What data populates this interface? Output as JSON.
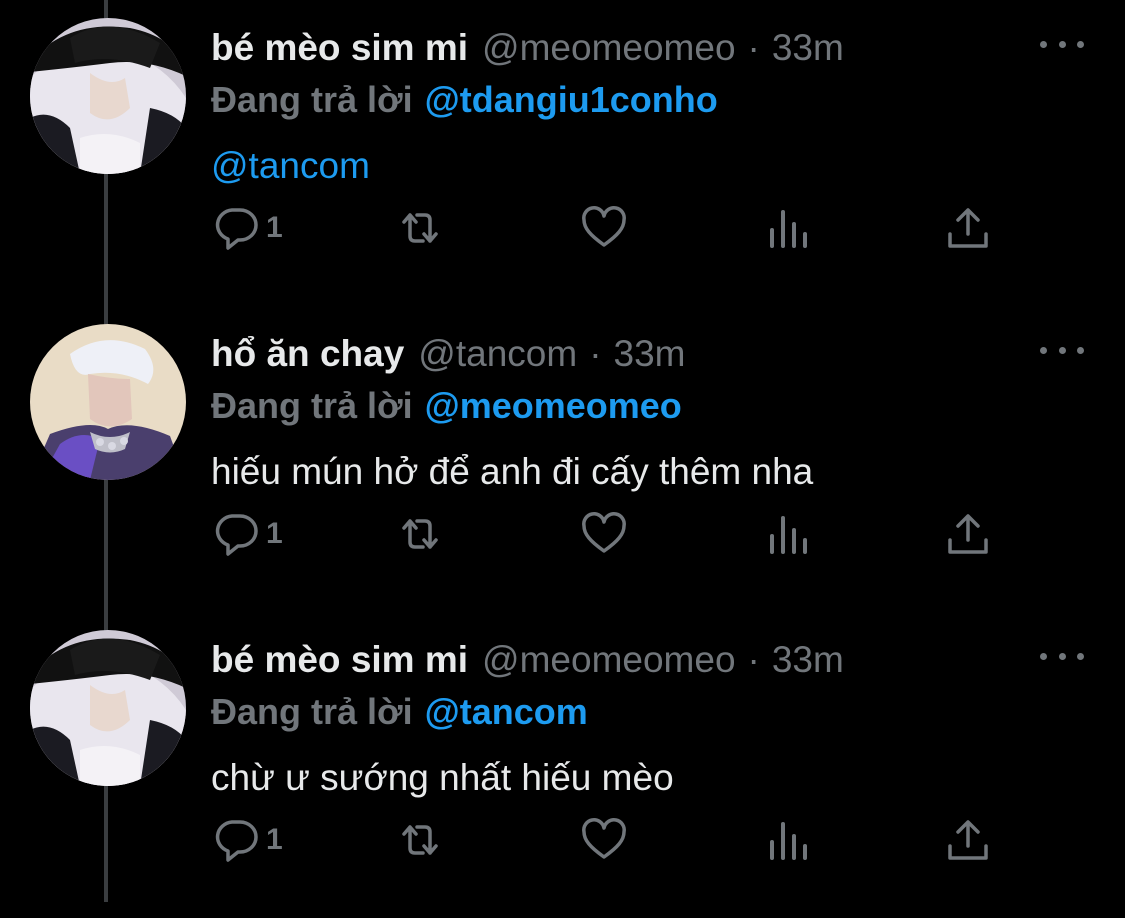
{
  "thread": {
    "tweets": [
      {
        "display_name": "bé mèo sim mi",
        "handle": "@meomeomeo",
        "separator": "·",
        "time": "33m",
        "reply_prefix": "Đang trả lời",
        "reply_to": "@tdangiu1conho",
        "text": "@tancom",
        "reply_count": "1",
        "avatar": "avatar-man-black-hat"
      },
      {
        "display_name": "hổ ăn chay",
        "handle": "@tancom",
        "separator": "·",
        "time": "33m",
        "reply_prefix": "Đang trả lời",
        "reply_to": "@meomeomeo",
        "text": "hiếu mún hở để anh đi cấy thêm nha",
        "reply_count": "1",
        "avatar": "avatar-man-silver-hair"
      },
      {
        "display_name": "bé mèo sim mi",
        "handle": "@meomeomeo",
        "separator": "·",
        "time": "33m",
        "reply_prefix": "Đang trả lời",
        "reply_to": "@tancom",
        "text": "chừ ư sướng nhất hiếu mèo",
        "reply_count": "1",
        "avatar": "avatar-man-black-hat"
      }
    ]
  },
  "icons": {
    "reply": "speech-bubble-icon",
    "retweet": "retweet-arrows-icon",
    "like": "heart-icon",
    "views": "bar-chart-icon",
    "share": "share-upload-icon",
    "more": "more-dots-icon"
  },
  "colors": {
    "background": "#000000",
    "text": "#e7e9ea",
    "muted": "#71767b",
    "mention": "#1d9bf0",
    "thread_line": "#3a3d40"
  }
}
